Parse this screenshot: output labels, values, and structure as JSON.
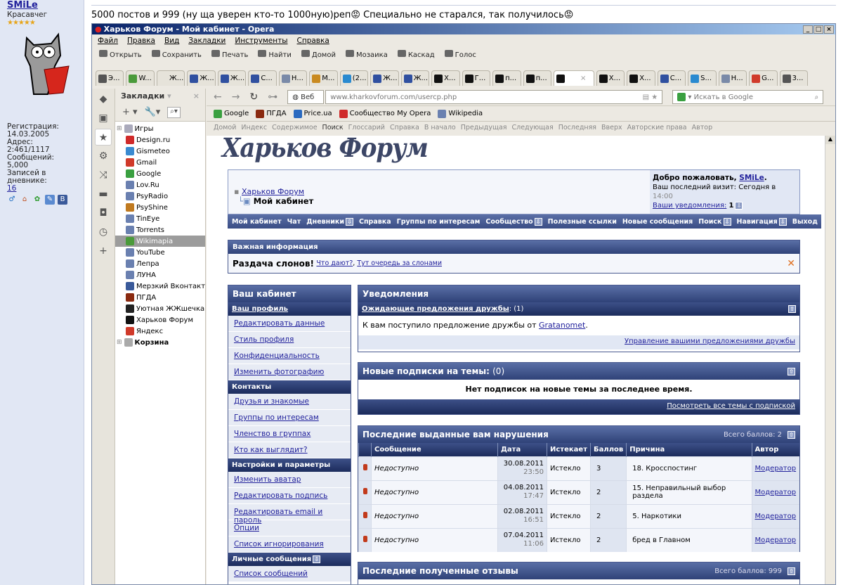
{
  "profile": {
    "username": "SMiLe",
    "title": "Красавчег",
    "stars": "★★★★★",
    "reg_label": "Регистрация:",
    "reg_date": "14.03.2005",
    "address": "Адрес: 2:461/1117",
    "posts": "Сообщений: 5,000",
    "diary_label": "Записей в дневнике:",
    "diary_count": "16"
  },
  "post_text": "5000 постов и 999 (ну ща уверен кто-то 1000ную)реп😡 Специально не старался, так получилось😡",
  "window": {
    "title": "Харьков Форум - Мой кабинет - Opera",
    "buttons": [
      "_",
      "□",
      "×"
    ]
  },
  "menu": [
    "Файл",
    "Правка",
    "Вид",
    "Закладки",
    "Инструменты",
    "Справка"
  ],
  "toolbar": [
    {
      "icon": "folder-icon",
      "label": "Открыть"
    },
    {
      "icon": "save-icon",
      "label": "Сохранить"
    },
    {
      "icon": "print-icon",
      "label": "Печать"
    },
    {
      "icon": "find-icon",
      "label": "Найти"
    },
    {
      "icon": "home-icon",
      "label": "Домой"
    },
    {
      "icon": "tile-icon",
      "label": "Мозаика"
    },
    {
      "icon": "cascade-icon",
      "label": "Каскад"
    },
    {
      "icon": "voice-icon",
      "label": "Голос"
    }
  ],
  "tabs": [
    {
      "label": "Э...",
      "color": "#555"
    },
    {
      "label": "W...",
      "color": "#4a9a3a"
    },
    {
      "label": "Ж...",
      "color": "#e6e3da"
    },
    {
      "label": "Ж...",
      "color": "#3050a0"
    },
    {
      "label": "Ж...",
      "color": "#3050a0"
    },
    {
      "label": "С...",
      "color": "#3050a0"
    },
    {
      "label": "Н...",
      "color": "#7a8aa8"
    },
    {
      "label": "М...",
      "color": "#c98a20"
    },
    {
      "label": "(2...",
      "color": "#2a8ad0"
    },
    {
      "label": "Ж...",
      "color": "#3050a0"
    },
    {
      "label": "Ж...",
      "color": "#3050a0"
    },
    {
      "label": "Х...",
      "color": "#111"
    },
    {
      "label": "Г...",
      "color": "#111"
    },
    {
      "label": "п...",
      "color": "#111"
    },
    {
      "label": "п...",
      "color": "#111"
    },
    {
      "label": "×",
      "color": "#111",
      "active": true
    },
    {
      "label": "Х...",
      "color": "#111"
    },
    {
      "label": "Х...",
      "color": "#111"
    },
    {
      "label": "С...",
      "color": "#3050a0"
    },
    {
      "label": "S...",
      "color": "#2a8ad0"
    },
    {
      "label": "Н...",
      "color": "#7a8aa8"
    },
    {
      "label": "G...",
      "color": "#d03a2a"
    },
    {
      "label": "3...",
      "color": "#555"
    }
  ],
  "sidebar_icons": [
    "google-icon",
    "km-icon",
    "bookmarks-star-icon",
    "settings-gear-icon",
    "share-icon",
    "notes-icon",
    "unite-icon",
    "history-clock-icon",
    "add-plus-icon"
  ],
  "bookmarks": {
    "title": "Закладки",
    "items": [
      {
        "label": "Игры",
        "color": "#aab",
        "folder": true
      },
      {
        "label": "Design.ru",
        "color": "#d02a2a"
      },
      {
        "label": "Gismeteo",
        "color": "#3a8ad0"
      },
      {
        "label": "Gmail",
        "color": "#d03a2a"
      },
      {
        "label": "Google",
        "color": "#3aa040"
      },
      {
        "label": "Lov.Ru",
        "color": "#6a80b0"
      },
      {
        "label": "PsyRadio",
        "color": "#6a80b0"
      },
      {
        "label": "PsyShine",
        "color": "#c07a20"
      },
      {
        "label": "TinEye",
        "color": "#6a80b0"
      },
      {
        "label": "Torrents",
        "color": "#6a80b0"
      },
      {
        "label": "Wikimapia",
        "color": "#4a9a3a",
        "selected": true
      },
      {
        "label": "YouTube",
        "color": "#6a80b0"
      },
      {
        "label": "Лепра",
        "color": "#6a80b0"
      },
      {
        "label": "ЛУНА",
        "color": "#6a80b0"
      },
      {
        "label": "Мерзкий Вконтакт",
        "color": "#3a5a9a"
      },
      {
        "label": "ПГДА",
        "color": "#8a2a10"
      },
      {
        "label": "Уютная ЖЖшечка",
        "color": "#222"
      },
      {
        "label": "Харьков Форум",
        "color": "#111"
      },
      {
        "label": "Яндекс",
        "color": "#d03a2a"
      },
      {
        "label": "Корзина",
        "color": "#aaa",
        "folder": true
      }
    ]
  },
  "address": {
    "mode": "Веб",
    "url": "www.kharkovforum.com/usercp.php",
    "search_placeholder": "Искать в Google"
  },
  "bookmark_bar": [
    {
      "label": "Google",
      "color": "#3aa040"
    },
    {
      "label": "ПГДА",
      "color": "#8a2a10"
    },
    {
      "label": "Price.ua",
      "color": "#2a6ac0"
    },
    {
      "label": "Сообщество My Opera",
      "color": "#d02a2a"
    },
    {
      "label": "Wikipedia",
      "color": "#6a80b0"
    }
  ],
  "nav_links": [
    "Домой",
    "Индекс",
    "Содержимое",
    "Поиск",
    "Глоссарий",
    "Справка",
    "В начало",
    "Предыдущая",
    "Следующая",
    "Последняя",
    "Вверх",
    "Авторские права",
    "Автор"
  ],
  "forum": {
    "logo": "Харьков Форум",
    "breadcrumb": {
      "root": "Харьков Форум",
      "current": "Мой кабинет"
    },
    "welcome": {
      "text": "Добро пожаловать, ",
      "user": "SMiLe",
      "last_visit": "Ваш последний визит: Сегодня в ",
      "time": "14:00",
      "notifications": "Ваши уведомления:",
      "count": "1"
    },
    "navbar": [
      "Мой кабинет",
      "Чат",
      "Дневники",
      "Справка",
      "Группы по интересам",
      "Сообщество",
      "Полезные ссылки",
      "Новые сообщения",
      "Поиск",
      "Навигация",
      "Выход"
    ],
    "important": {
      "title": "Важная информация",
      "text": "Раздача слонов!",
      "link1": "Что дают?",
      "link2": "Тут очередь за слонами"
    },
    "left_menu": {
      "title": "Ваш кабинет",
      "sections": [
        {
          "title": "Ваш профиль",
          "link": true,
          "items": [
            "Редактировать данные",
            "Стиль профиля",
            "Конфиденциальность",
            "Изменить фотографию"
          ]
        },
        {
          "title": "Контакты",
          "items": [
            "Друзья и знакомые",
            "Группы по интересам",
            "Членство в группах",
            "Кто как выглядит?"
          ]
        },
        {
          "title": "Настройки и параметры",
          "items": [
            "Изменить аватар",
            "Редактировать подпись",
            "Редактировать email и пароль",
            "Опции",
            "Список игнорирования"
          ]
        },
        {
          "title": "Личные сообщения",
          "items": [
            "Список сообщений"
          ]
        }
      ]
    },
    "notifications": {
      "title": "Уведомления",
      "sub": "Ожидающие предложения дружбы",
      "sub_count": ": (1)",
      "text": "К вам поступило предложение дружбы от ",
      "user": "Gratanomet",
      "footer": "Управление вашими предложениями дружбы"
    },
    "subscriptions": {
      "title": "Новые подписки на темы:",
      "count": "(0)",
      "text": "Нет подписок на новые темы за последнее время.",
      "footer": "Посмотреть все темы с подпиской"
    },
    "infractions": {
      "title": "Последние выданные вам нарушения",
      "total": "Всего баллов: 2",
      "columns": [
        "",
        "Сообщение",
        "Дата",
        "Истекает",
        "Баллов",
        "Причина",
        "Автор"
      ],
      "rows": [
        {
          "message": "Недоступно",
          "date": "30.08.2011",
          "time": "23:50",
          "expires": "Истекло",
          "points": "3",
          "reason": "18. Кросспостинг",
          "author": "Модератор"
        },
        {
          "message": "Недоступно",
          "date": "04.08.2011",
          "time": "17:47",
          "expires": "Истекло",
          "points": "2",
          "reason": "15. Неправильный выбор раздела",
          "author": "Модератор"
        },
        {
          "message": "Недоступно",
          "date": "02.08.2011",
          "time": "16:51",
          "expires": "Истекло",
          "points": "2",
          "reason": "5. Наркотики",
          "author": "Модератор"
        },
        {
          "message": "Недоступно",
          "date": "07.04.2011",
          "time": "11:06",
          "expires": "Истекло",
          "points": "2",
          "reason": "бред в Главном",
          "author": "Модератор"
        }
      ]
    },
    "feedback": {
      "title": "Последние полученные отзывы",
      "total": "Всего баллов: 999"
    }
  }
}
